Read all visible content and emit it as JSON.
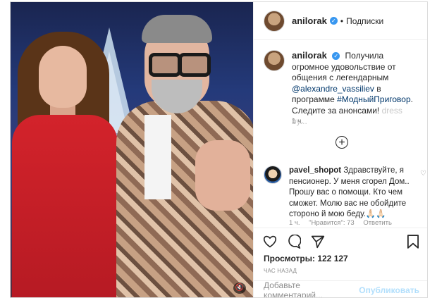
{
  "post": {
    "username": "anilorak",
    "follow_label": "Подписки",
    "dot": "•",
    "caption": {
      "text1": "Получила огромное удовольствие от общения с легендарным",
      "mention": "@alexandre_vassiliev",
      "text2": "в программе",
      "hashtag": "#МодныйПриговор",
      "text3": ". Следите за анонсами!",
      "faded": "dress by..."
    },
    "time": "1 ч.",
    "comment": {
      "username": "pavel_shopot",
      "text": "Здравствуйте, я пенсионер. У меня сгорел Дом.. Прошу вас о помощи. Кто чем сможет. Молю вас не обойдите стороно й мою беду.🙏🏻🙏🏻",
      "time": "1 ч.",
      "likes": "\"Нравится\": 73",
      "reply": "Ответить"
    },
    "views": "Просмотры: 122 127",
    "ago": "ЧАС НАЗАД",
    "add_comment_placeholder": "Добавьте комментарий...",
    "publish": "Опубликовать"
  },
  "icons": [
    "heart-icon",
    "comment-icon",
    "share-icon",
    "bookmark-icon",
    "mute-icon",
    "verified-icon",
    "add-icon"
  ],
  "colors": {
    "link": "#00376b",
    "verified": "#3897f0",
    "publish": "#b2dffc",
    "muted_text": "#8e8e8e"
  }
}
